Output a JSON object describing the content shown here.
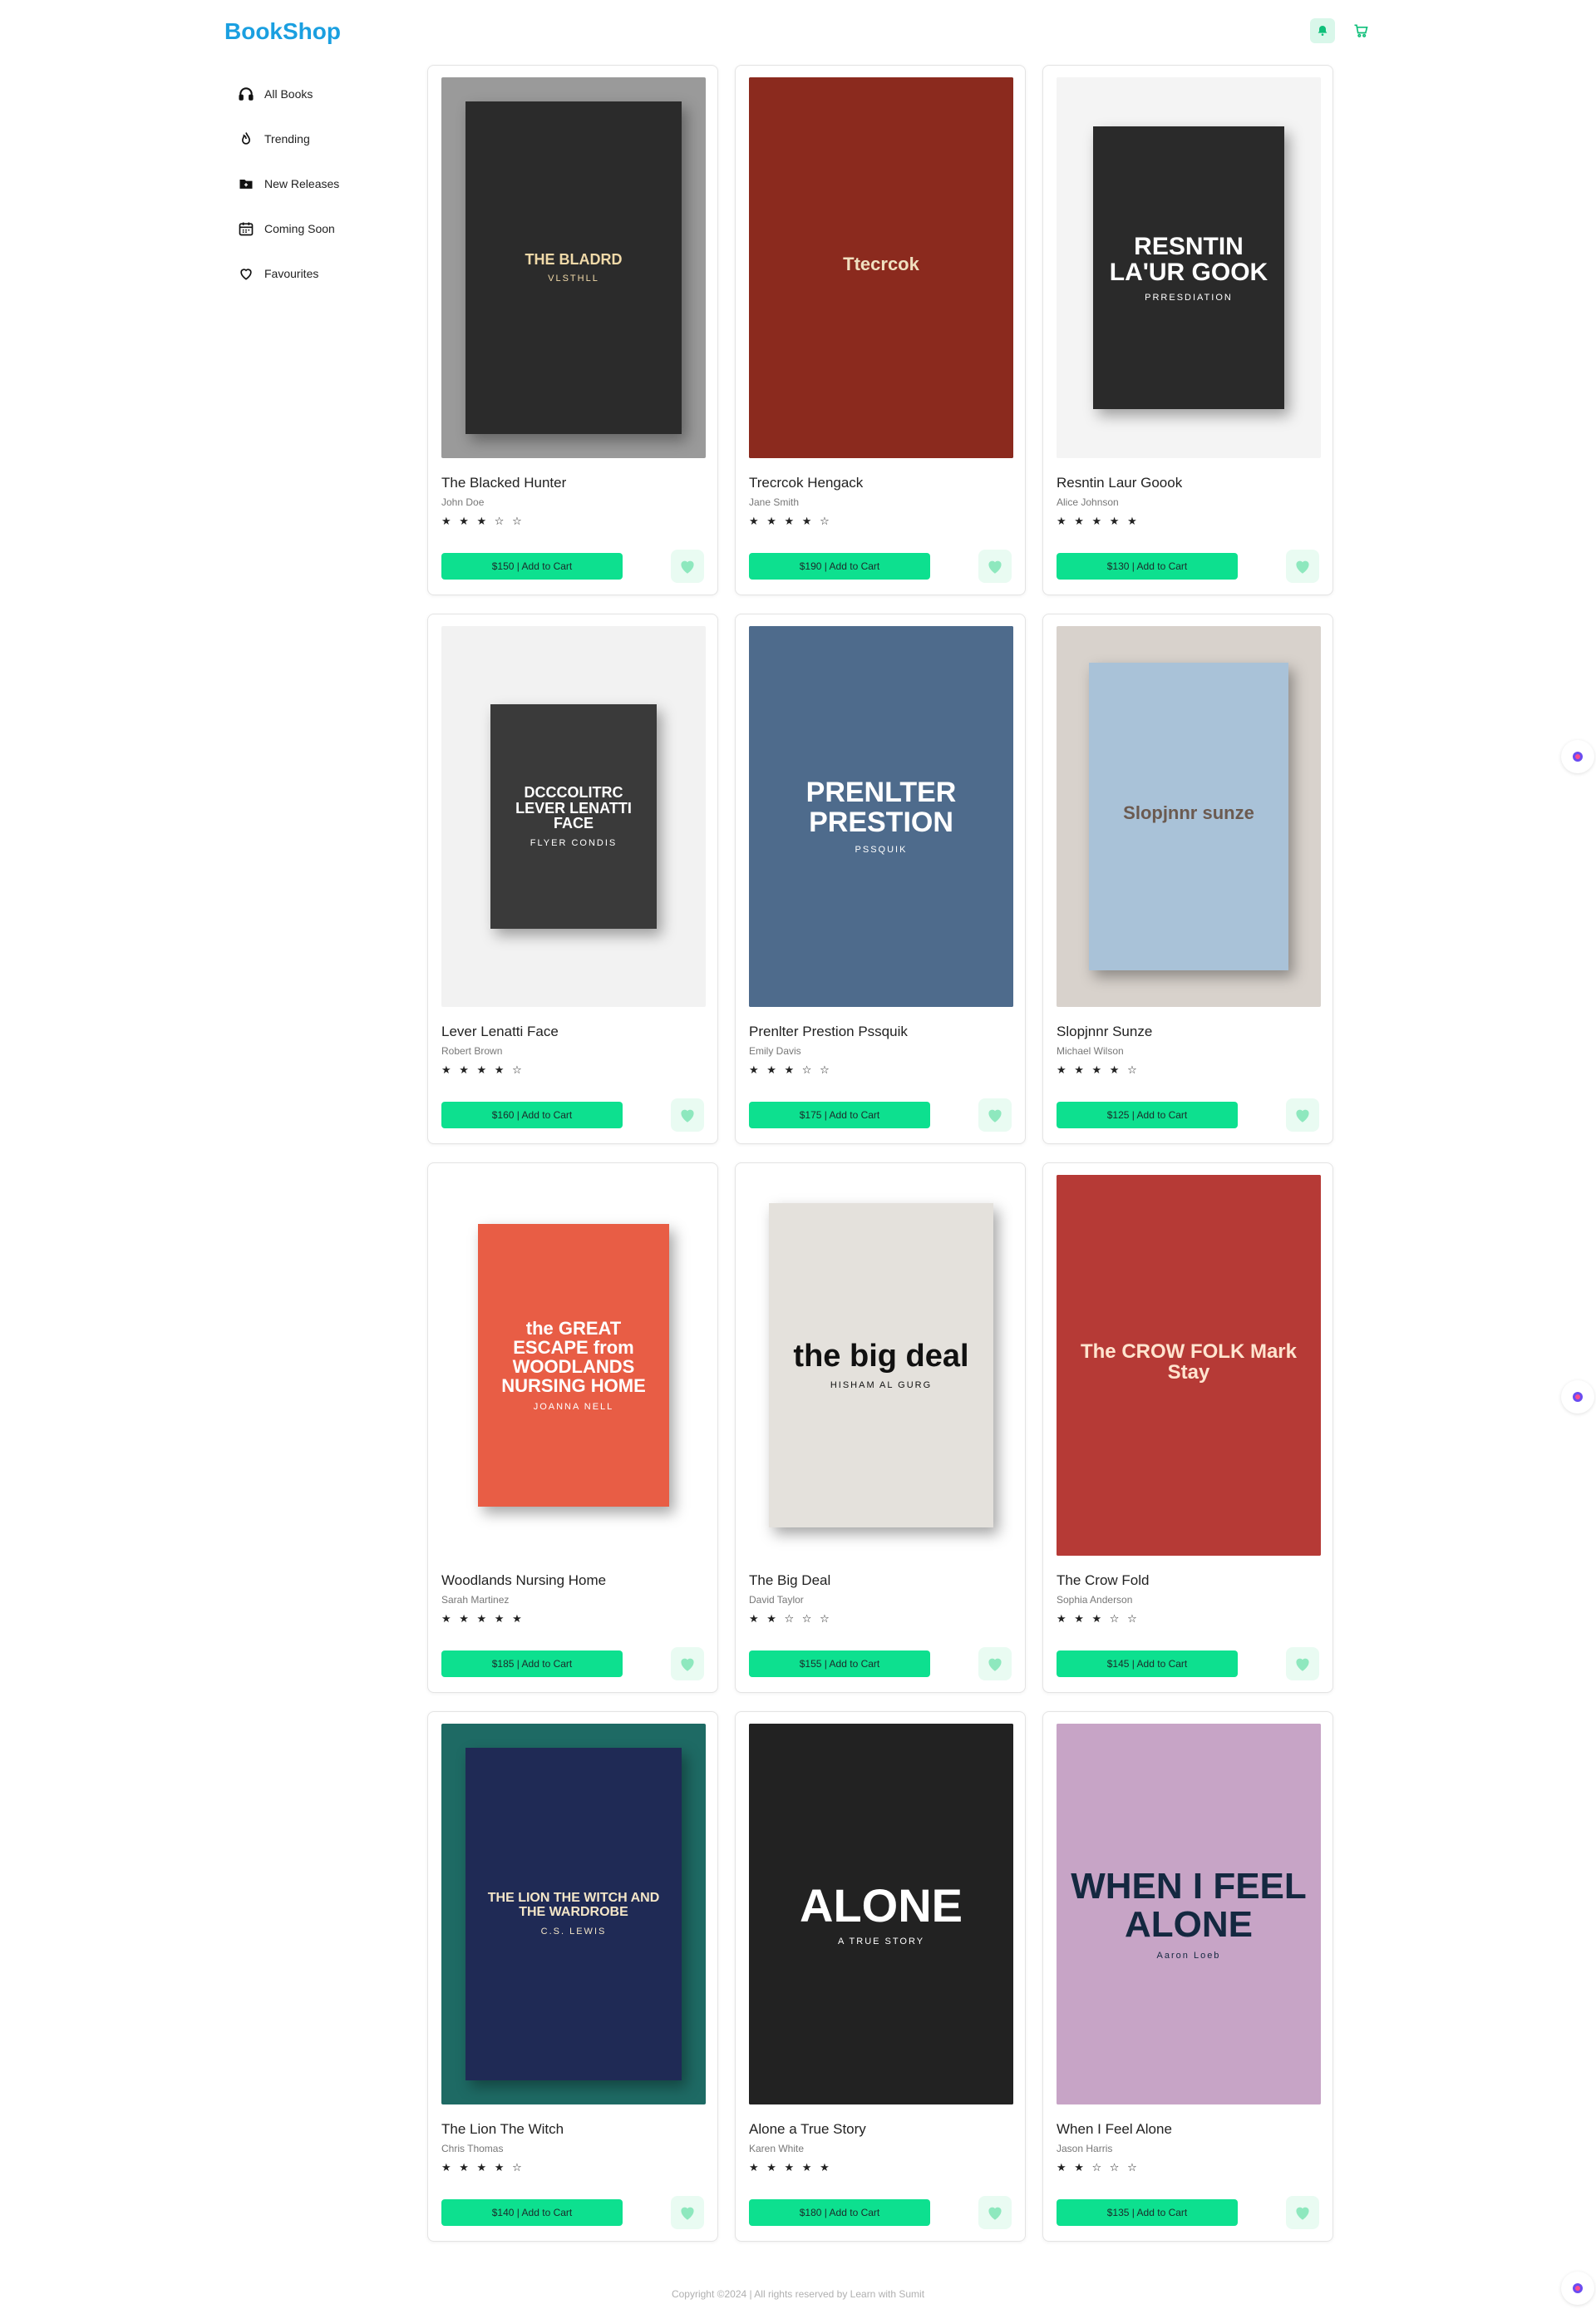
{
  "app": {
    "logo": "BookShop"
  },
  "colors": {
    "brand": "#1a9fe0",
    "accent": "#0de08f",
    "fav_bg": "#e9fbf2"
  },
  "header_icons": [
    "bell-icon",
    "cart-icon"
  ],
  "sidebar": {
    "items": [
      {
        "label": "All Books",
        "icon": "headphones-icon"
      },
      {
        "label": "Trending",
        "icon": "flame-icon"
      },
      {
        "label": "New Releases",
        "icon": "folder-icon"
      },
      {
        "label": "Coming Soon",
        "icon": "calendar-icon"
      },
      {
        "label": "Favourites",
        "icon": "heart-icon"
      }
    ]
  },
  "books": [
    {
      "title": "The Blacked Hunter",
      "author": "John Doe",
      "stars": "★ ★ ★ ☆ ☆",
      "rating": 3,
      "cart_label": "$150 | Add to Cart",
      "cover": {
        "bg": "#9a9a9a",
        "fg": "#f0d9a8",
        "text": "THE BLADRD",
        "sub": "VLSTHLL"
      }
    },
    {
      "title": "Trecrcok Hengack",
      "author": "Jane Smith",
      "stars": "★ ★ ★ ★ ☆",
      "rating": 4,
      "cart_label": "$190 | Add to Cart",
      "cover": {
        "bg": "#3a3a3a",
        "fg": "#f0e0c0",
        "text": "Ttecrcok",
        "sub": ""
      }
    },
    {
      "title": "Resntin Laur Goook",
      "author": "Alice Johnson",
      "stars": "★ ★ ★ ★ ★",
      "rating": 5,
      "cart_label": "$130 | Add to Cart",
      "cover": {
        "bg": "#f4f4f4",
        "fg": "#ffffff",
        "text": "RESNTIN LA'UR GOOK",
        "sub": "PRRESDIATION"
      }
    },
    {
      "title": "Lever Lenatti Face",
      "author": "Robert Brown",
      "stars": "★ ★ ★ ★ ☆",
      "rating": 4,
      "cart_label": "$160 | Add to Cart",
      "cover": {
        "bg": "#f2f2f2",
        "fg": "#ffffff",
        "text": "DCCCOLITRC LEVER LENATTI FACE",
        "sub": "FLYER CONDIS"
      }
    },
    {
      "title": "Prenlter Prestion Pssquik",
      "author": "Emily Davis",
      "stars": "★ ★ ★ ☆ ☆",
      "rating": 3,
      "cart_label": "$175 | Add to Cart",
      "cover": {
        "bg": "#5a7799",
        "fg": "#ffffff",
        "text": "PRENLTER PRESTION",
        "sub": "PSSQUIK"
      }
    },
    {
      "title": "Slopjnnr Sunze",
      "author": "Michael Wilson",
      "stars": "★ ★ ★ ★ ☆",
      "rating": 4,
      "cart_label": "$125 | Add to Cart",
      "cover": {
        "bg": "#d8d2cc",
        "fg": "#6b5a50",
        "text": "Slopjnnr sunze",
        "sub": ""
      }
    },
    {
      "title": "Woodlands Nursing Home",
      "author": "Sarah Martinez",
      "stars": "★ ★ ★ ★ ★",
      "rating": 5,
      "cart_label": "$185 | Add to Cart",
      "cover": {
        "bg": "#ffffff",
        "fg": "#ffffff",
        "text": "the GREAT ESCAPE from WOODLANDS NURSING HOME",
        "sub": "JOANNA NELL"
      }
    },
    {
      "title": "The Big Deal",
      "author": "David Taylor",
      "stars": "★ ★ ☆ ☆ ☆",
      "rating": 2,
      "cart_label": "$155 | Add to Cart",
      "cover": {
        "bg": "#ffffff",
        "fg": "#111111",
        "text": "the big deal",
        "sub": "HISHAM AL GURG"
      }
    },
    {
      "title": "The Crow Fold",
      "author": "Sophia Anderson",
      "stars": "★ ★ ★ ☆ ☆",
      "rating": 3,
      "cart_label": "$145 | Add to Cart",
      "cover": {
        "bg": "#c94a3c",
        "fg": "#ffe4cf",
        "text": "The CROW FOLK Mark Stay",
        "sub": ""
      }
    },
    {
      "title": "The Lion The Witch",
      "author": "Chris Thomas",
      "stars": "★ ★ ★ ★ ☆",
      "rating": 4,
      "cart_label": "$140 | Add to Cart",
      "cover": {
        "bg": "#1e6a64",
        "fg": "#f4e6c8",
        "text": "THE LION THE WITCH AND THE WARDROBE",
        "sub": "C.S. LEWIS"
      }
    },
    {
      "title": "Alone a True Story",
      "author": "Karen White",
      "stars": "★ ★ ★ ★ ★",
      "rating": 5,
      "cart_label": "$180 | Add to Cart",
      "cover": {
        "bg": "#1c1c1c",
        "fg": "#ffffff",
        "text": "ALONE",
        "sub": "A TRUE STORY"
      }
    },
    {
      "title": "When I Feel Alone",
      "author": "Jason Harris",
      "stars": "★ ★ ☆ ☆ ☆",
      "rating": 2,
      "cart_label": "$135 | Add to Cart",
      "cover": {
        "bg": "#c9a8c4",
        "fg": "#142840",
        "text": "WHEN I FEEL ALONE",
        "sub": "Aaron Loeb"
      }
    }
  ],
  "footer": {
    "text": "Copyright ©2024 | All rights reserved by Learn with Sumit"
  }
}
